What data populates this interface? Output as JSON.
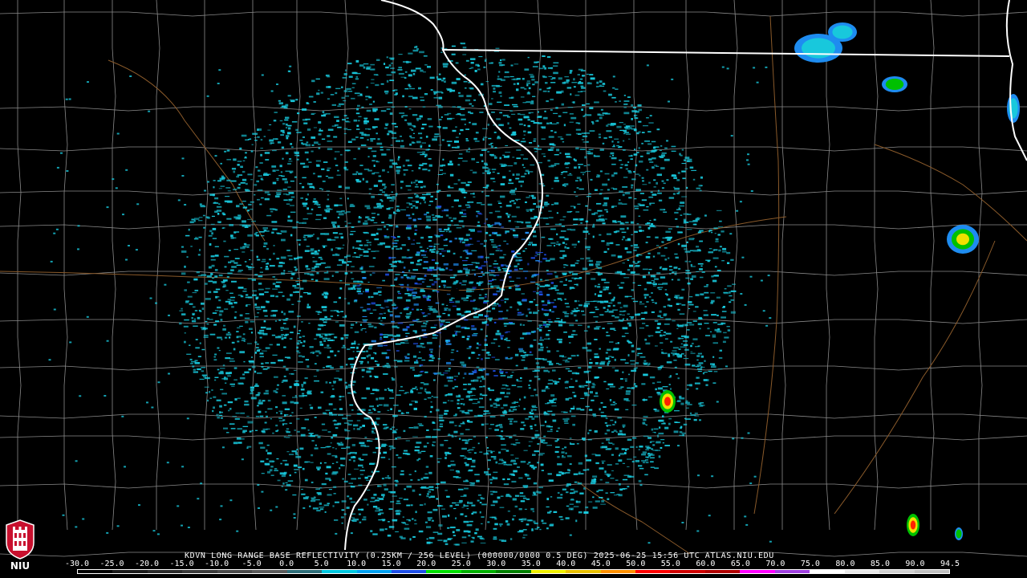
{
  "radar": {
    "caption": "KDVN LONG RANGE BASE REFLECTIVITY (0.25KM / 256 LEVEL) (000000/0000 0.5 DEG) 2025-06-25 15:56 UTC  ATLAS.NIU.EDU",
    "site": "KDVN"
  },
  "colorbar": {
    "labels": [
      "-30.0",
      "-25.0",
      "-20.0",
      "-15.0",
      "-10.0",
      "-5.0",
      "0.0",
      "5.0",
      "10.0",
      "15.0",
      "20.0",
      "25.0",
      "30.0",
      "35.0",
      "40.0",
      "45.0",
      "50.0",
      "55.0",
      "60.0",
      "65.0",
      "70.0",
      "75.0",
      "80.0",
      "85.0",
      "90.0",
      "94.5"
    ],
    "colors": [
      "#000000",
      "#1a1a1a",
      "#2a2a2a",
      "#3a3a3a",
      "#4a4a4a",
      "#5a5a5a",
      "#2f6f7a",
      "#00c8e0",
      "#00a0f0",
      "#1e4fe8",
      "#00e000",
      "#00b000",
      "#008000",
      "#f0f000",
      "#e8c000",
      "#ff9000",
      "#ff0000",
      "#d00000",
      "#b00000",
      "#ff00ff",
      "#a040e0",
      "#ffffff",
      "#e8e8e8",
      "#d0d0d0",
      "#c0c0c0"
    ]
  },
  "map": {
    "county_line_color": "#8a8a8a",
    "state_line_color": "#ffffff",
    "river_color": "#8a5a2a",
    "echo_colors": {
      "light": "#18c8dc",
      "medium": "#1e8cf0",
      "strong": "#1e4fe8",
      "green": "#00c000",
      "yellow": "#f0e000",
      "red": "#ff2000"
    }
  },
  "logo": {
    "text": "NIU",
    "color": "#c8102e"
  }
}
